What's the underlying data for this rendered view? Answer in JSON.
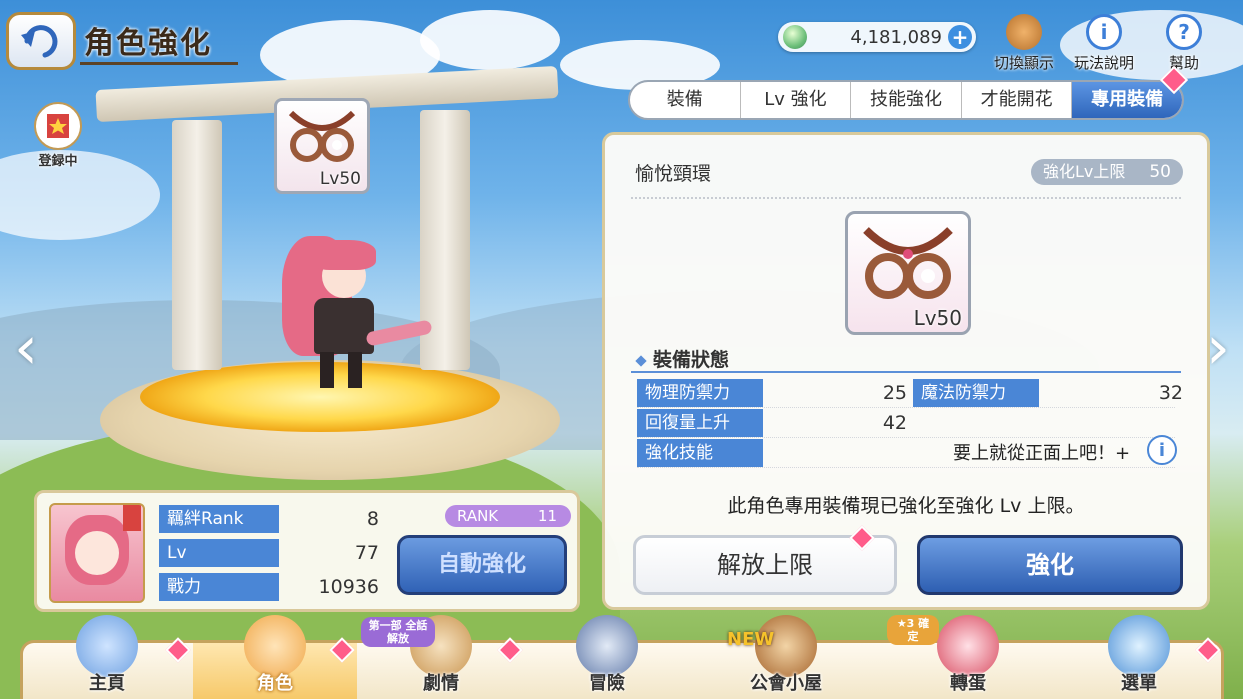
{
  "header": {
    "title": "角色強化"
  },
  "currency": {
    "mana": "4,181,089"
  },
  "tools": [
    {
      "label": "切換顯示",
      "icon": "toggle-display-icon"
    },
    {
      "label": "玩法說明",
      "icon": "info-icon"
    },
    {
      "label": "幫助",
      "icon": "help-icon"
    }
  ],
  "registering": {
    "label": "登録中"
  },
  "stage": {
    "equip_level": "Lv50"
  },
  "character": {
    "stats": [
      {
        "label": "羈絆Rank",
        "value": "8"
      },
      {
        "label": "Lv",
        "value": "77"
      },
      {
        "label": "戰力",
        "value": "10936"
      }
    ],
    "rank_label": "RANK",
    "rank_value": "11",
    "auto_button": "自動強化"
  },
  "tabs": [
    "裝備",
    "Lv 強化",
    "技能強化",
    "才能開花",
    "專用裝備"
  ],
  "active_tab": "專用裝備",
  "equipment": {
    "name": "愉悅頸環",
    "cap_label": "強化Lv上限",
    "cap_value": "50",
    "level": "Lv50",
    "status_header": "裝備狀態",
    "props": [
      {
        "label": "物理防禦力",
        "value": "25"
      },
      {
        "label": "魔法防禦力",
        "value": "32"
      },
      {
        "label": "回復量上升",
        "value": "42"
      },
      {
        "label": "強化技能",
        "value": ""
      }
    ],
    "skill_text": "要上就從正面上吧！+",
    "max_message": "此角色專用裝備現已強化至強化 Lv 上限。",
    "release_button": "解放上限",
    "enhance_button": "強化"
  },
  "nav": {
    "items": [
      {
        "label": "主頁"
      },
      {
        "label": "角色"
      },
      {
        "label": "劇情"
      },
      {
        "label": "冒險"
      },
      {
        "label": "公會小屋"
      },
      {
        "label": "轉蛋"
      },
      {
        "label": "選單"
      }
    ],
    "story_badge": "第一部 全話解放",
    "guild_badge": "NEW",
    "gacha_badge": "★3 確定"
  },
  "colors": {
    "accent": "#4a86d6",
    "gem": "#ff5c8a",
    "frame": "#c5a35e"
  }
}
